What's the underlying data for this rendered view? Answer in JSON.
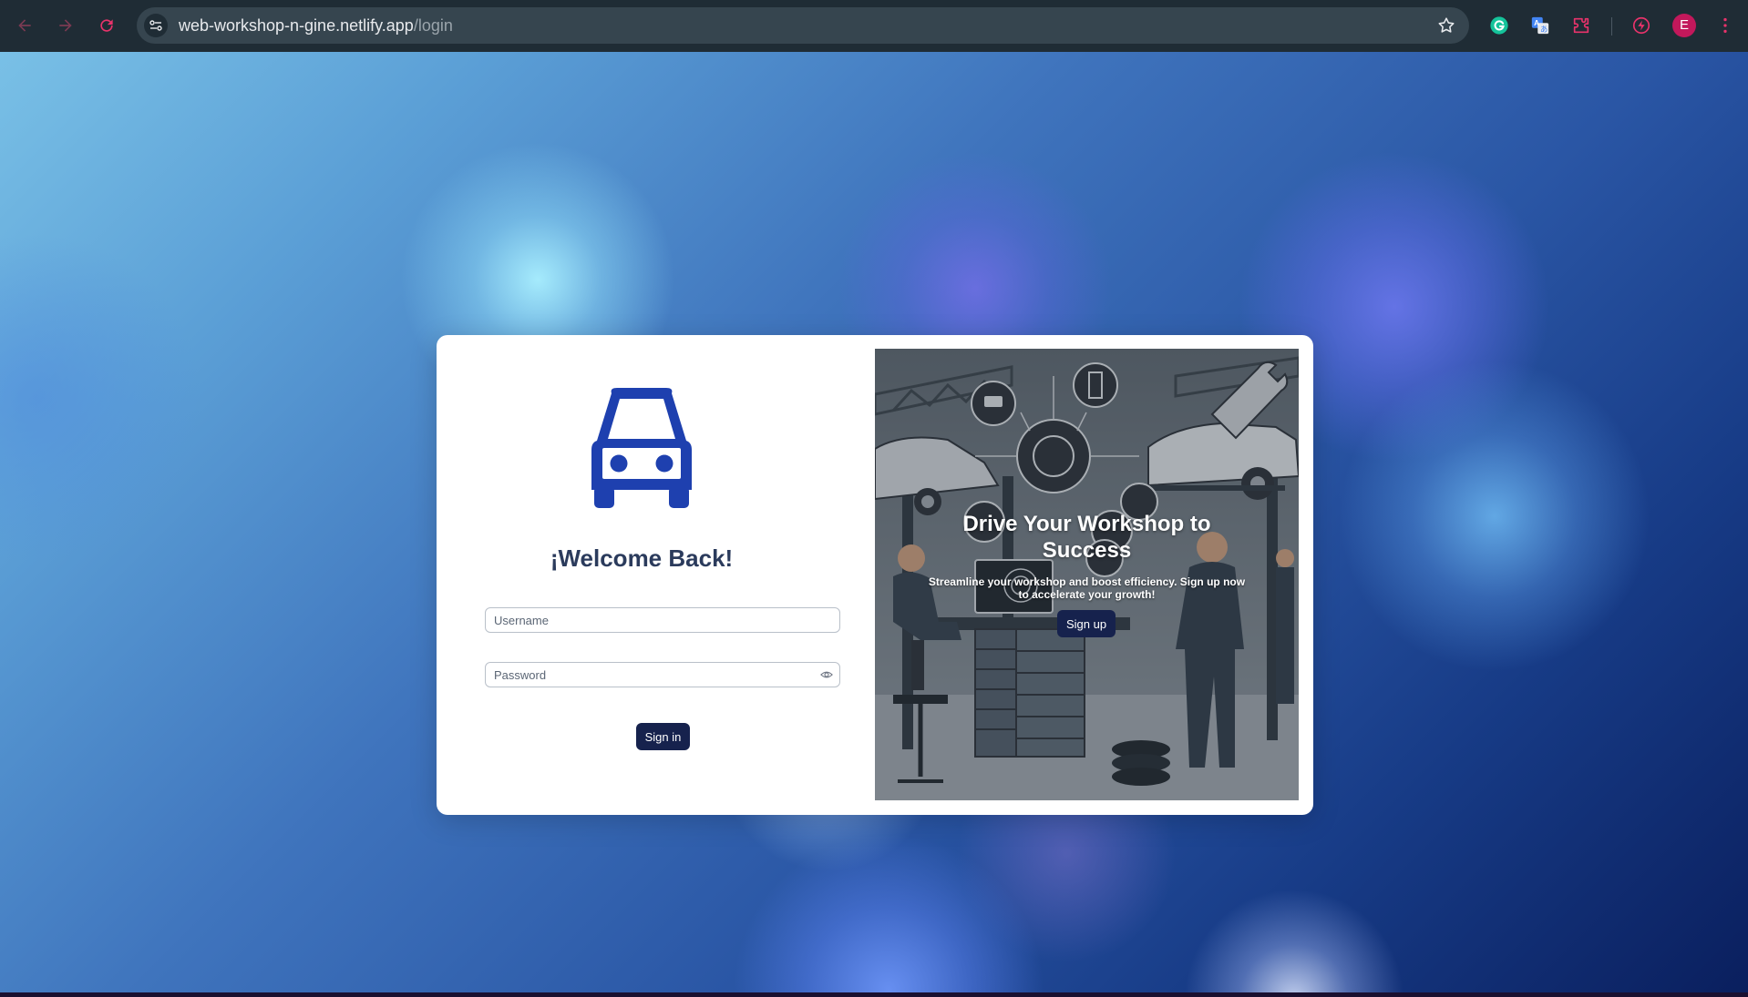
{
  "browser": {
    "url_host": "web-workshop-n-gine.netlify.app",
    "url_path": "/login",
    "profile_initial": "E",
    "icons": [
      "back-arrow-icon",
      "forward-arrow-icon",
      "reload-icon",
      "site-info-icon",
      "bookmark-star-icon",
      "grammarly-icon",
      "translate-icon",
      "extensions-puzzle-icon",
      "performance-icon",
      "profile-avatar"
    ]
  },
  "login": {
    "logo_icon": "car-icon",
    "heading": "¡Welcome Back!",
    "username_placeholder": "Username",
    "password_placeholder": "Password",
    "show_password_icon": "eye-icon",
    "signin_label": "Sign in"
  },
  "promo": {
    "title": "Drive Your Workshop to Success",
    "subtitle": "Streamline your workshop and boost efficiency. Sign up now to accelerate your growth!",
    "signup_label": "Sign up"
  },
  "colors": {
    "brand_blue": "#1e40af",
    "button_navy": "#16224d",
    "heading": "#2b3b5c",
    "chrome_bg": "#1f2c35",
    "omnibox_bg": "#36454f",
    "accent_pink": "#e8336b",
    "avatar": "#c2185b"
  }
}
